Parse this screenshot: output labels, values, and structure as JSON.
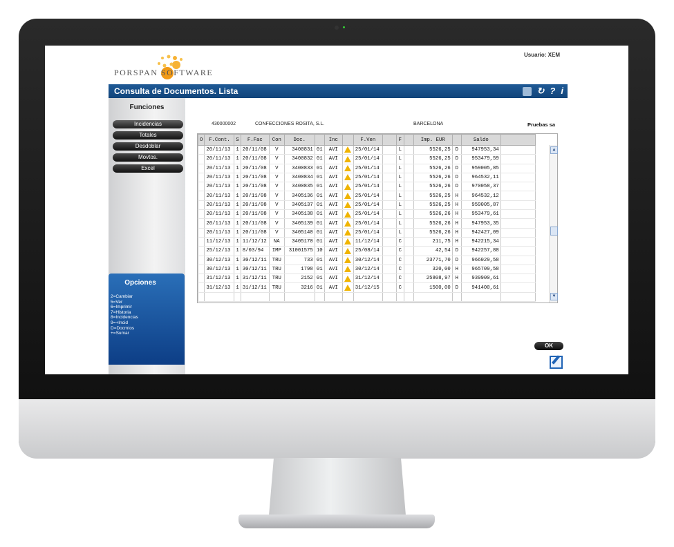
{
  "app": {
    "logo_text": "PORSPAN SOFTWARE",
    "user_label": "Usuario: XEM",
    "title": "Consulta de Documentos. Lista",
    "help_icon": "?",
    "info_icon": "i"
  },
  "sidebar": {
    "title": "Funciones",
    "buttons": [
      "Incidencias",
      "Totales",
      "Desdoblar",
      "Movtos.",
      "Excel"
    ]
  },
  "opciones": {
    "title": "Opciones",
    "items": [
      "2=Cambiar",
      "5=Ver",
      "6=Imprimir",
      "7=Historia",
      "8=Incidencias",
      "9=+Incid",
      "D=Docmtos",
      "+=Sumar"
    ]
  },
  "header": {
    "code": "430000002",
    "name": "CONFECCIONES ROSITA, S.L.",
    "city": "BARCELONA",
    "env": "Pruebas sa"
  },
  "table": {
    "columns": [
      "O",
      "F.Cont.",
      "S",
      "F.Fac",
      "Con",
      "Doc.",
      "",
      "Inc",
      "",
      "F.Ven",
      "",
      "F",
      "",
      "Imp. EUR",
      "",
      "Saldo"
    ],
    "rows": [
      [
        "",
        "20/11/13",
        "1",
        "20/11/08",
        "V",
        "3400831",
        "01",
        "AVI",
        "warn",
        "25/01/14",
        "",
        "L",
        "",
        "5526,25",
        "D",
        "947953,34"
      ],
      [
        "",
        "20/11/13",
        "1",
        "20/11/08",
        "V",
        "3400832",
        "01",
        "AVI",
        "warn",
        "25/01/14",
        "",
        "L",
        "",
        "5526,25",
        "D",
        "953479,59"
      ],
      [
        "",
        "20/11/13",
        "1",
        "20/11/08",
        "V",
        "3400833",
        "01",
        "AVI",
        "warn",
        "25/01/14",
        "",
        "L",
        "",
        "5526,26",
        "D",
        "959005,85"
      ],
      [
        "",
        "20/11/13",
        "1",
        "20/11/08",
        "V",
        "3400834",
        "01",
        "AVI",
        "warn",
        "25/01/14",
        "",
        "L",
        "",
        "5526,26",
        "D",
        "964532,11"
      ],
      [
        "",
        "20/11/13",
        "1",
        "20/11/08",
        "V",
        "3400835",
        "01",
        "AVI",
        "warn",
        "25/01/14",
        "",
        "L",
        "",
        "5526,26",
        "D",
        "970058,37"
      ],
      [
        "",
        "20/11/13",
        "1",
        "20/11/08",
        "V",
        "3405136",
        "01",
        "AVI",
        "warn",
        "25/01/14",
        "",
        "L",
        "",
        "5526,25",
        "H",
        "964532,12"
      ],
      [
        "",
        "20/11/13",
        "1",
        "20/11/08",
        "V",
        "3405137",
        "01",
        "AVI",
        "warn",
        "25/01/14",
        "",
        "L",
        "",
        "5526,25",
        "H",
        "959005,87"
      ],
      [
        "",
        "20/11/13",
        "1",
        "20/11/08",
        "V",
        "3405138",
        "01",
        "AVI",
        "warn",
        "25/01/14",
        "",
        "L",
        "",
        "5526,26",
        "H",
        "953479,61"
      ],
      [
        "",
        "20/11/13",
        "1",
        "20/11/08",
        "V",
        "3405139",
        "01",
        "AVI",
        "warn",
        "25/01/14",
        "",
        "L",
        "",
        "5526,26",
        "H",
        "947953,35"
      ],
      [
        "",
        "20/11/13",
        "1",
        "20/11/08",
        "V",
        "3405140",
        "01",
        "AVI",
        "warn",
        "25/01/14",
        "",
        "L",
        "",
        "5526,26",
        "H",
        "942427,09"
      ],
      [
        "",
        "11/12/13",
        "1",
        "11/12/12",
        "NA",
        "3405170",
        "01",
        "AVI",
        "warn",
        "11/12/14",
        "",
        "C",
        "",
        "211,75",
        "H",
        "942215,34"
      ],
      [
        "",
        "25/12/13",
        "1",
        "8/03/94",
        "IMP",
        "31001575",
        "10",
        "AVI",
        "warn",
        "25/08/14",
        "",
        "C",
        "",
        "42,54",
        "D",
        "942257,88"
      ],
      [
        "",
        "30/12/13",
        "1",
        "30/12/11",
        "TRU",
        "733",
        "01",
        "AVI",
        "warn",
        "30/12/14",
        "",
        "C",
        "",
        "23771,70",
        "D",
        "966029,58"
      ],
      [
        "",
        "30/12/13",
        "1",
        "30/12/11",
        "TRU",
        "1798",
        "01",
        "AVI",
        "warn",
        "30/12/14",
        "",
        "C",
        "",
        "320,00",
        "H",
        "965709,58"
      ],
      [
        "",
        "31/12/13",
        "1",
        "31/12/11",
        "TRU",
        "2152",
        "01",
        "AVI",
        "warn",
        "31/12/14",
        "",
        "C",
        "",
        "25808,97",
        "H",
        "939900,61"
      ],
      [
        "",
        "31/12/13",
        "1",
        "31/12/11",
        "TRU",
        "3216",
        "01",
        "AVI",
        "warn",
        "31/12/15",
        "",
        "C",
        "",
        "1500,00",
        "D",
        "941400,61"
      ]
    ]
  },
  "ok_label": "OK",
  "colors": {
    "title_bar": "#1f5a96",
    "opciones_bg": "#1c58a4",
    "warn": "#f0b400"
  }
}
